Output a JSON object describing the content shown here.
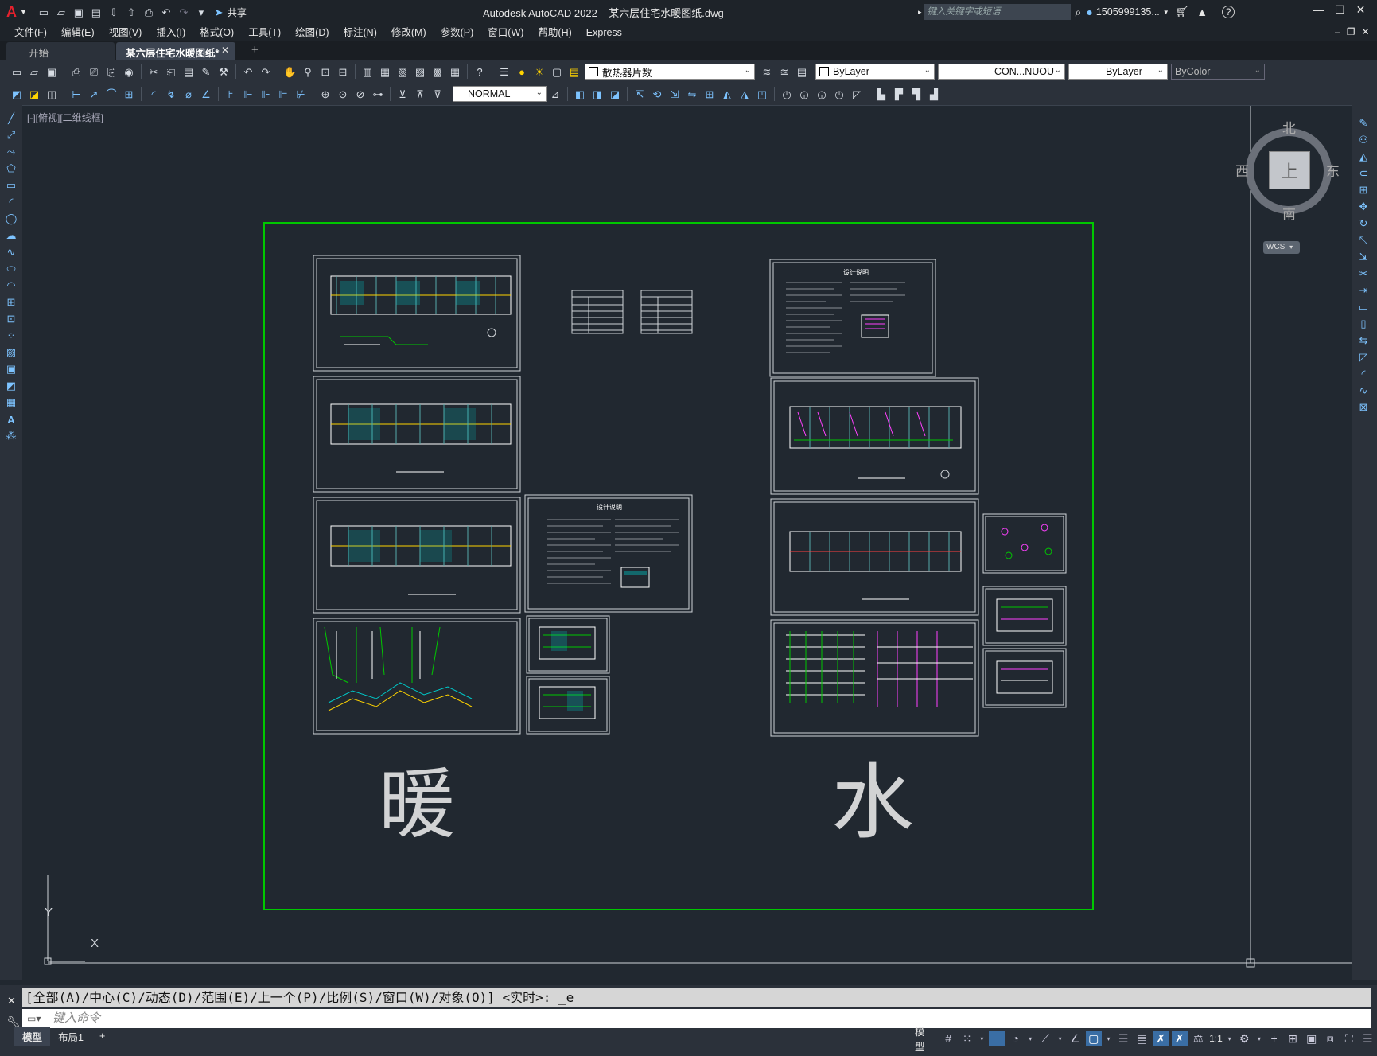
{
  "title_bar": {
    "app_logo": "A",
    "share": "共享",
    "title": "Autodesk AutoCAD 2022    某六层住宅水暖图纸.dwg",
    "search_placeholder": "键入关键字或短语",
    "user": "1505999135...",
    "help": "?"
  },
  "menu": [
    "文件(F)",
    "编辑(E)",
    "视图(V)",
    "插入(I)",
    "格式(O)",
    "工具(T)",
    "绘图(D)",
    "标注(N)",
    "修改(M)",
    "参数(P)",
    "窗口(W)",
    "帮助(H)",
    "Express"
  ],
  "tabs": {
    "start": "开始",
    "doc": "某六层住宅水暖图纸*",
    "add": "+"
  },
  "toolbar": {
    "layer": "散热器片数",
    "color": "ByLayer",
    "linetype": "CON...NUOU",
    "lineweight": "ByLayer",
    "plotstyle": "ByColor",
    "textstyle": "NORMAL"
  },
  "viewport": {
    "label": "[-][俯视][二维线框]",
    "viewcube": {
      "north": "北",
      "south": "南",
      "east": "东",
      "west": "西",
      "top": "上",
      "wcs": "WCS"
    },
    "ucs": {
      "x": "X",
      "y": "Y"
    },
    "label_heating": "暖",
    "label_water": "水",
    "notes_title": "设计说明",
    "notes_title2": "设计说明"
  },
  "command": {
    "history": "[全部(A)/中心(C)/动态(D)/范围(E)/上一个(P)/比例(S)/窗口(W)/对象(O)] <实时>: _e",
    "placeholder": "键入命令"
  },
  "status": {
    "model_tab": "模型",
    "layout_tab": "布局1",
    "add": "+",
    "model_btn": "模型",
    "scale": "1:1"
  },
  "colors": {
    "canvas_bg": "#212830",
    "frame_green": "#00c800",
    "accent_blue": "#3a6ea5"
  }
}
